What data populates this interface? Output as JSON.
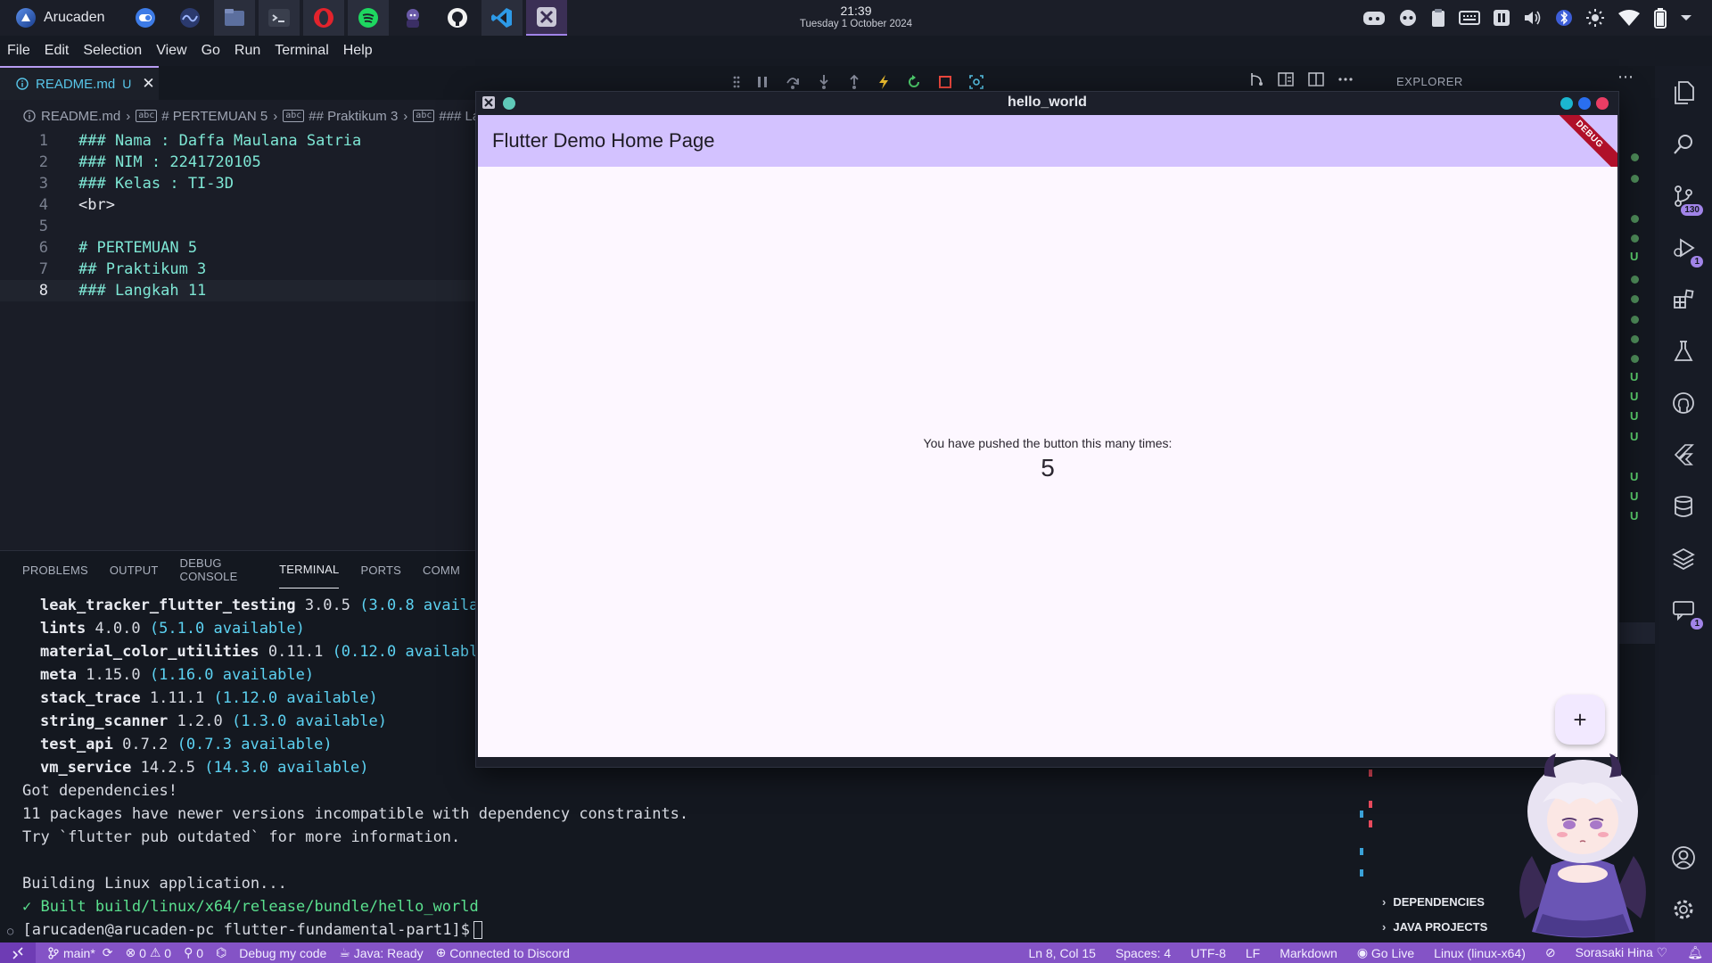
{
  "system": {
    "distro_name": "Arucaden",
    "clock_time": "21:39",
    "clock_date": "Tuesday 1 October 2024"
  },
  "menu": [
    "File",
    "Edit",
    "Selection",
    "View",
    "Go",
    "Run",
    "Terminal",
    "Help"
  ],
  "editor": {
    "tab": {
      "label": "README.md",
      "status": "U"
    },
    "breadcrumb": [
      "README.md",
      "# PERTEMUAN 5",
      "## Praktikum 3",
      "### La"
    ],
    "lines": [
      {
        "n": "1",
        "text": "### Nama : Daffa Maulana Satria"
      },
      {
        "n": "2",
        "text": "### NIM : 2241720105"
      },
      {
        "n": "3",
        "text": "### Kelas : TI-3D"
      },
      {
        "n": "4",
        "text": "<br>"
      },
      {
        "n": "5",
        "text": ""
      },
      {
        "n": "6",
        "text": "# PERTEMUAN 5"
      },
      {
        "n": "7",
        "text": "## Praktikum 3"
      },
      {
        "n": "8",
        "text": "### Langkah 11"
      }
    ]
  },
  "panel": {
    "tabs": [
      "PROBLEMS",
      "OUTPUT",
      "DEBUG CONSOLE",
      "TERMINAL",
      "PORTS",
      "COMM"
    ],
    "packages": [
      {
        "name": "leak_tracker_flutter_testing",
        "ver": "3.0.5",
        "avail": "(3.0.8 availab"
      },
      {
        "name": "lints",
        "ver": "4.0.0",
        "avail": "(5.1.0 available)"
      },
      {
        "name": "material_color_utilities",
        "ver": "0.11.1",
        "avail": "(0.12.0 available"
      },
      {
        "name": "meta",
        "ver": "1.15.0",
        "avail": "(1.16.0 available)"
      },
      {
        "name": "stack_trace",
        "ver": "1.11.1",
        "avail": "(1.12.0 available)"
      },
      {
        "name": "string_scanner",
        "ver": "1.2.0",
        "avail": "(1.3.0 available)"
      },
      {
        "name": "test_api",
        "ver": "0.7.2",
        "avail": "(0.7.3 available)"
      },
      {
        "name": "vm_service",
        "ver": "14.2.5",
        "avail": "(14.3.0 available)"
      }
    ],
    "got_deps": "Got dependencies!",
    "newer_msg": "11 packages have newer versions incompatible with dependency constraints.",
    "try_msg": "Try `flutter pub outdated` for more information.",
    "building": "Building Linux application...",
    "built": "✓ Built build/linux/x64/release/bundle/hello_world",
    "prompt": "[arucaden@arucaden-pc flutter-fundamental-part1]$"
  },
  "explorer": {
    "title": "EXPLORER",
    "git_markers": [
      "dot",
      "dot",
      "dot",
      "dot",
      "U",
      "dot",
      "dot",
      "dot",
      "dot",
      "dot",
      "U",
      "U",
      "U",
      "U",
      "U",
      "U",
      "U"
    ],
    "sections": [
      "DEPENDENCIES",
      "JAVA PROJECTS"
    ]
  },
  "activity_badges": {
    "scm": "130",
    "debug": "1",
    "chat": "1"
  },
  "statusbar": {
    "branch": "main*",
    "errors": "0",
    "warnings": "0",
    "ports": "0",
    "debug": "Debug my code",
    "java": "Java: Ready",
    "discord": "Connected to Discord",
    "position": "Ln 8, Col 15",
    "spaces": "Spaces: 4",
    "encoding": "UTF-8",
    "eol": "LF",
    "language": "Markdown",
    "golive": "Go Live",
    "platform": "Linux (linux-x64)",
    "user": "Sorasaki Hina ♡"
  },
  "app": {
    "window_title": "hello_world",
    "appbar_title": "Flutter Demo Home Page",
    "debug_banner": "DEBUG",
    "message": "You have pushed the button this many times:",
    "counter": "5",
    "fab_symbol": "+"
  },
  "colors": {
    "accent": "#8453c6",
    "appbar": "#d3c2ff",
    "terminal_available": "#5cd2f2",
    "terminal_success": "#5ae08e",
    "markdown_heading": "#7ee7d5"
  }
}
